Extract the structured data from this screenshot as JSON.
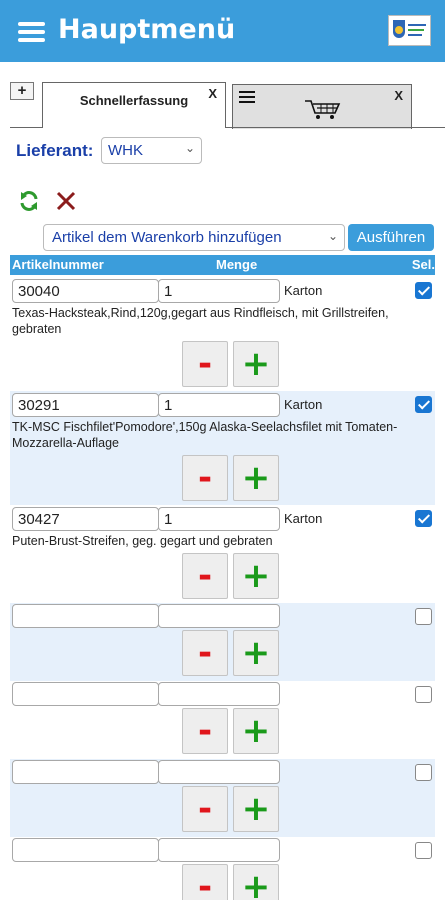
{
  "header": {
    "title": "Hauptmenü"
  },
  "tabs": {
    "add_label": "+",
    "active_label": "Schnellerfassung",
    "close_label": "X"
  },
  "supplier": {
    "label": "Lieferant:",
    "value": "WHK"
  },
  "actions": {
    "select_value": "Artikel dem Warenkorb hinzufügen",
    "execute_label": "Ausführen"
  },
  "columns": {
    "article": "Artikelnummer",
    "quantity": "Menge",
    "select": "Sel."
  },
  "rows": [
    {
      "article": "30040",
      "quantity": "1",
      "unit": "Karton",
      "selected": true,
      "description": "Texas-Hacksteak,Rind,120g,gegart aus Rindfleisch, mit Grillstreifen, gebraten"
    },
    {
      "article": "30291",
      "quantity": "1",
      "unit": "Karton",
      "selected": true,
      "description": "TK-MSC Fischfilet'Pomodore',150g Alaska-Seelachsfilet mit Tomaten-Mozzarella-Auflage"
    },
    {
      "article": "30427",
      "quantity": "1",
      "unit": "Karton",
      "selected": true,
      "description": "Puten-Brust-Streifen, geg. gegart und gebraten"
    },
    {
      "article": "",
      "quantity": "",
      "unit": "",
      "selected": false,
      "description": ""
    },
    {
      "article": "",
      "quantity": "",
      "unit": "",
      "selected": false,
      "description": ""
    },
    {
      "article": "",
      "quantity": "",
      "unit": "",
      "selected": false,
      "description": ""
    },
    {
      "article": "",
      "quantity": "",
      "unit": "",
      "selected": false,
      "description": ""
    }
  ],
  "buttons": {
    "minus": "-",
    "plus": "+"
  },
  "colors": {
    "accent": "#3b9ddb",
    "row_alt": "#e6f0fb",
    "minus": "#e0161c",
    "plus": "#1a9a1a",
    "link": "#1a3fa8"
  },
  "icons": {
    "menu": "hamburger-icon",
    "refresh": "refresh-icon",
    "delete": "close-x-icon",
    "cart": "shopping-cart-icon"
  }
}
